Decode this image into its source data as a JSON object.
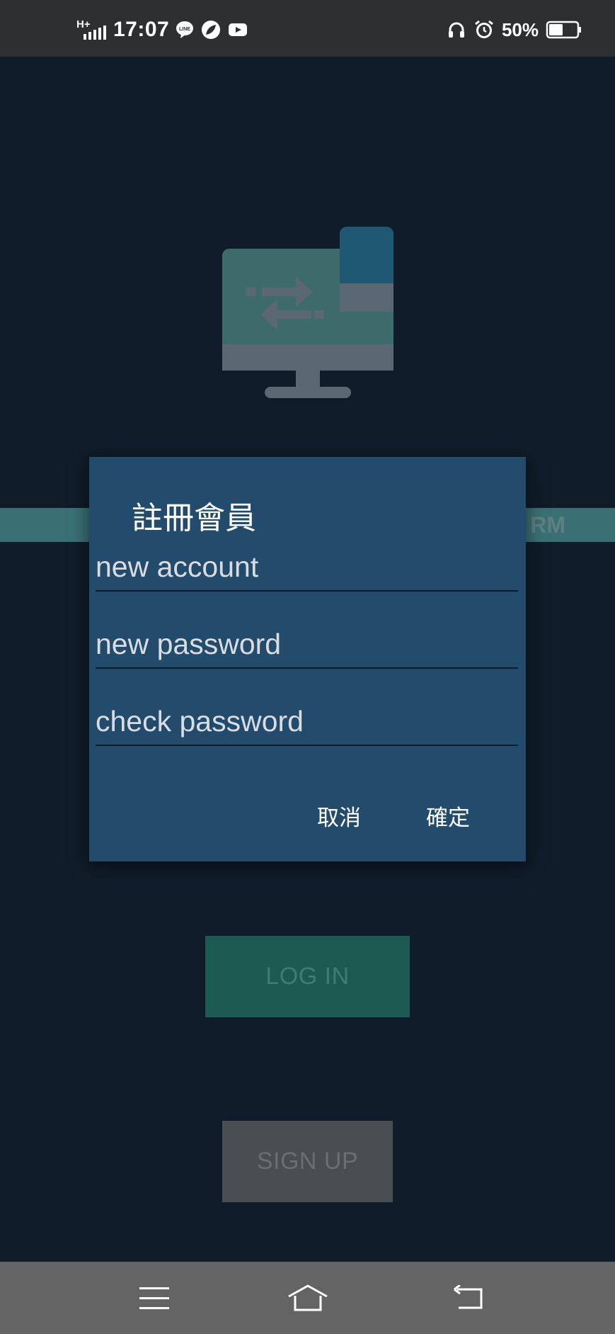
{
  "status_bar": {
    "network": "H+",
    "time": "17:07",
    "battery_percent": "50%",
    "battery_level": 0.5,
    "left_icons": [
      "line-icon",
      "leaf-icon",
      "youtube-icon"
    ],
    "right_icons": [
      "headphones-icon",
      "alarm-icon",
      "battery-icon"
    ]
  },
  "background": {
    "banner_text": "RM",
    "login_label": "LOG IN",
    "signup_label": "SIGN UP",
    "hero_icon": "monitor-transfer-icon"
  },
  "dialog": {
    "title": "註冊會員",
    "fields": [
      {
        "placeholder": "new account",
        "value": ""
      },
      {
        "placeholder": "new password",
        "value": ""
      },
      {
        "placeholder": "check password",
        "value": ""
      }
    ],
    "cancel_label": "取消",
    "confirm_label": "確定"
  },
  "nav_bar": {
    "icons": [
      "menu-icon",
      "home-icon",
      "back-icon"
    ]
  },
  "colors": {
    "page_bg": "#101c29",
    "dialog_bg": "#224b6c",
    "banner": "#3a7074",
    "login_button": "#1d5a52",
    "signup_button": "#4a4e53",
    "nav_bar": "#646464"
  }
}
